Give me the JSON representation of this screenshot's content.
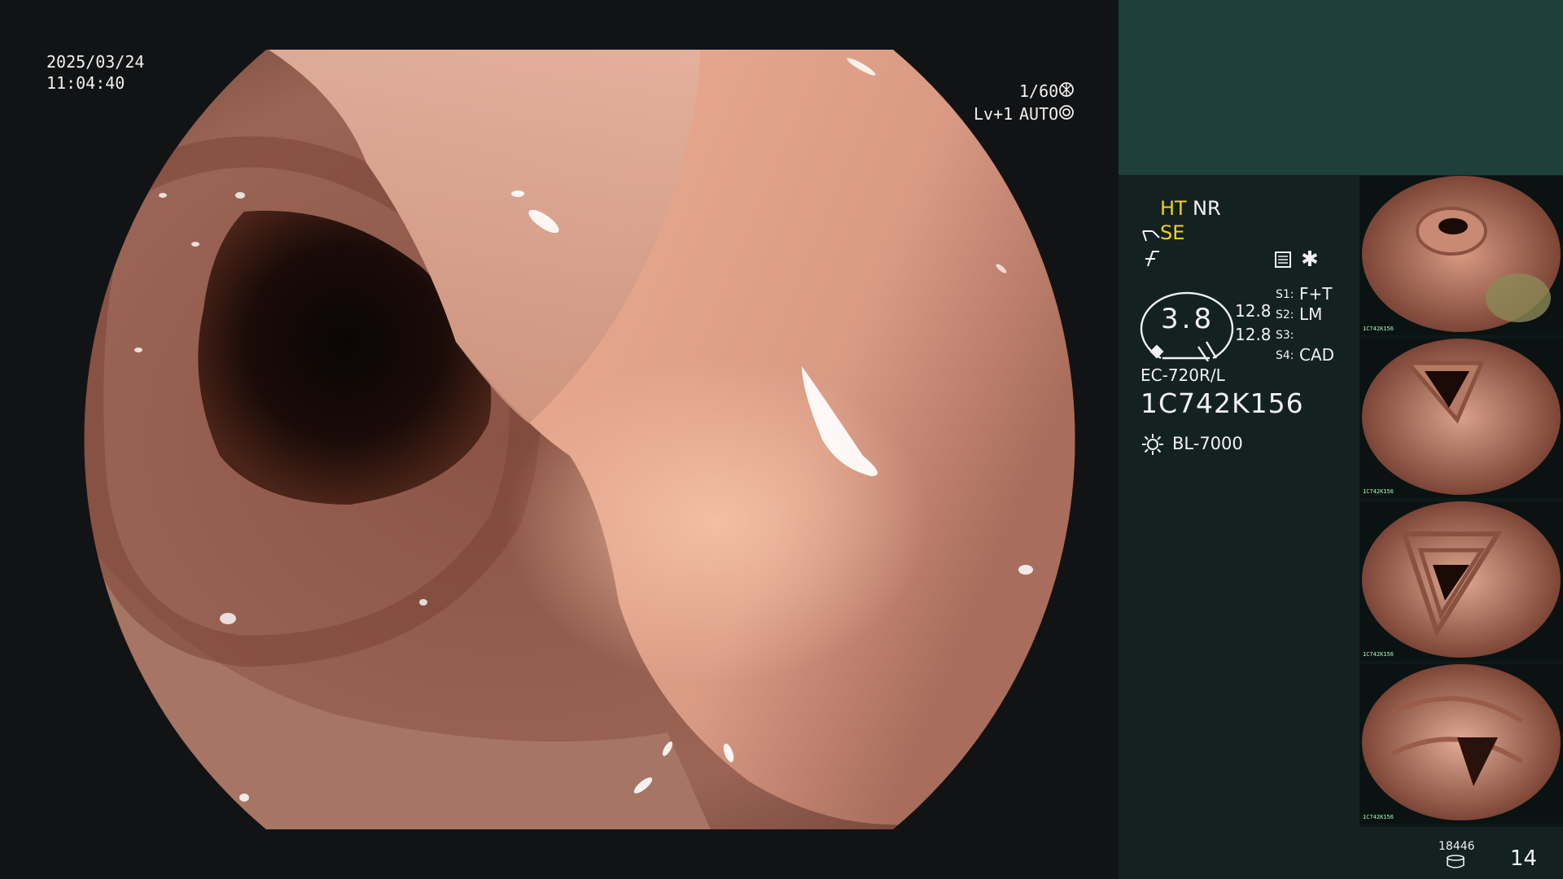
{
  "overlay": {
    "date": "2025/03/24",
    "time": "11:04:40",
    "shutter": "1/60",
    "level": "Lv+1",
    "exposure": "AUTO"
  },
  "settings": {
    "ht": "HT",
    "nr": "NR",
    "se": "SE",
    "gauge_value": "3.8",
    "value_a": "12.8",
    "value_b": "12.8",
    "s1_key": "S1:",
    "s1_val": "F+T",
    "s2_key": "S2:",
    "s2_val": "LM",
    "s3_key": "S3:",
    "s3_val": "",
    "s4_key": "S4:",
    "s4_val": "CAD",
    "scope_model": "EC-720R/L",
    "scope_serial": "1C742K156",
    "light_source": "BL-7000"
  },
  "thumbnails": [
    {
      "caption": "1C742K156"
    },
    {
      "caption": "1C742K156"
    },
    {
      "caption": "1C742K156"
    },
    {
      "caption": "1C742K156"
    }
  ],
  "footer": {
    "storage_count": "18446",
    "image_count": "14"
  },
  "colors": {
    "panel_top": "#1d403a",
    "panel": "#142121",
    "accent_yellow": "#f2d21a",
    "tissue": "#b98270"
  },
  "icons": [
    "shutter-icon",
    "exposure-icon",
    "structure-enhance-icon",
    "freeze-icon",
    "menu-icon",
    "asterisk-icon",
    "light-source-icon",
    "storage-icon"
  ]
}
